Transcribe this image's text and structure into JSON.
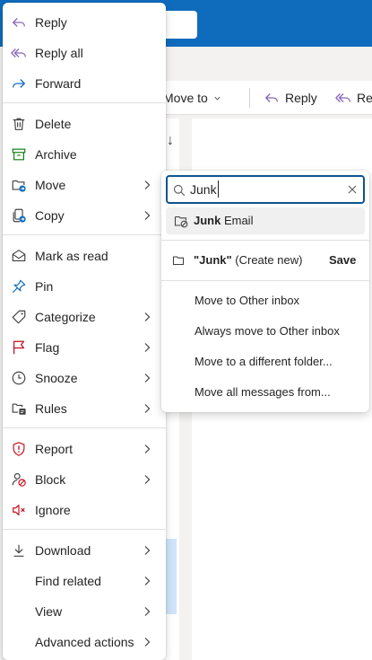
{
  "toolbar": {
    "move_to": "Move to",
    "reply": "Reply",
    "reply_partial": "Rep"
  },
  "menu": {
    "reply": "Reply",
    "reply_all": "Reply all",
    "forward": "Forward",
    "delete": "Delete",
    "archive": "Archive",
    "move": "Move",
    "copy": "Copy",
    "mark_as_read": "Mark as read",
    "pin": "Pin",
    "categorize": "Categorize",
    "flag": "Flag",
    "snooze": "Snooze",
    "rules": "Rules",
    "report": "Report",
    "block": "Block",
    "ignore": "Ignore",
    "download": "Download",
    "find_related": "Find related",
    "view": "View",
    "advanced_actions": "Advanced actions"
  },
  "move_submenu": {
    "search_value": "Junk",
    "suggestion_bold": "Junk",
    "suggestion_rest": " Email",
    "create_quoted": "\"Junk\"",
    "create_rest": " (Create new)",
    "save": "Save",
    "options": [
      "Move to Other inbox",
      "Always move to Other inbox",
      "Move to a different folder...",
      "Move all messages from..."
    ]
  },
  "icons": {
    "reply": "reply-icon",
    "reply_all": "reply-all-icon",
    "forward": "forward-icon",
    "delete": "trash-icon",
    "archive": "archive-icon",
    "move": "folder-move-icon",
    "copy": "copy-icon",
    "mark_as_read": "envelope-open-icon",
    "pin": "pin-icon",
    "categorize": "tag-icon",
    "flag": "flag-icon",
    "snooze": "clock-icon",
    "rules": "rules-icon",
    "report": "shield-alert-icon",
    "block": "block-icon",
    "ignore": "mute-icon",
    "download": "download-icon"
  },
  "colors": {
    "brand_blue": "#0f6cbd",
    "focus_border": "#0f548c",
    "reply_all_purple": "#8764b8",
    "flag_red": "#c50f1f",
    "archive_green": "#107c10"
  }
}
